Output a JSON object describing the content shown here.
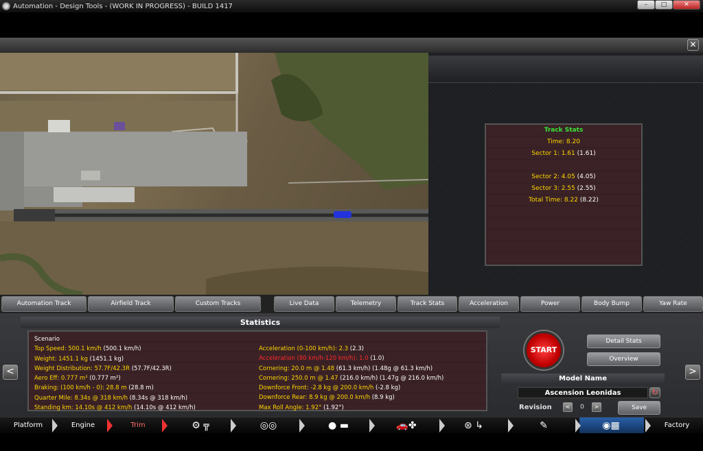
{
  "window": {
    "title": "Automation - Design Tools - (WORK IN PROGRESS) - BUILD 1417",
    "minimize": "–",
    "maximize": "□",
    "close": "✕"
  },
  "panel": {
    "close": "✕"
  },
  "track_stats": {
    "title": "Track Stats",
    "time": "Time: 8.20",
    "lines": [
      {
        "label": "Sector 1: 1.61",
        "paren": "(1.61)"
      },
      {
        "label": "",
        "paren": ""
      },
      {
        "label": "Sector 2: 4.05",
        "paren": "(4.05)"
      },
      {
        "label": "Sector 3: 2.55",
        "paren": "(2.55)"
      },
      {
        "label": "Total Time: 8.22",
        "paren": "(8.22)"
      }
    ]
  },
  "tabs": [
    "Automation Track",
    "Airfield Track",
    "Custom Tracks",
    "Live Data",
    "Telemetry",
    "Track Stats",
    "Acceleration",
    "Power",
    "Body Bump",
    "Yaw Rate"
  ],
  "statistics": {
    "header": "Statistics",
    "scenario": "Scenario",
    "left": [
      {
        "label": "Top Speed: 500.1 km/h",
        "paren": "(500.1 km/h)"
      },
      {
        "label": "Weight: 1451.1 kg",
        "paren": "(1451.1 kg)"
      },
      {
        "label": "Weight Distribution: 57.7F/42.3R",
        "paren": "(57.7F/42.3R)"
      },
      {
        "label": "Aero Eff: 0.777 m²",
        "paren": "(0.777 m²)"
      },
      {
        "label": "Braking: (100 km/h - 0): 28.8 m",
        "paren": "(28.8 m)"
      },
      {
        "label": "Quarter Mile: 8.34s @ 318 km/h",
        "paren": "(8.34s @ 318 km/h)"
      },
      {
        "label": "Standing km: 14.10s @ 412 km/h",
        "paren": "(14.10s @ 412 km/h)"
      }
    ],
    "right": [
      {
        "label": "Acceleration (0-100 km/h): 2.3",
        "paren": "(2.3)"
      },
      {
        "label": "Acceleration (80 km/h-120 km/h): 1.0",
        "paren": "(1.0)"
      },
      {
        "label": "Cornering: 20.0 m @ 1.48",
        "paren": "(61.3 km/h) (1.48g @ 61.3 km/h)"
      },
      {
        "label": "Cornering: 250.0 m @ 1.47",
        "paren": "(216.0 km/h) (1.47g @ 216.0 km/h)"
      },
      {
        "label": "Downforce Front: -2.8 kg @ 200.0 km/h",
        "paren": "(-2.8 kg)"
      },
      {
        "label": "Downforce Rear: 8.9 kg @ 200.0 km/h",
        "paren": "(8.9 kg)"
      },
      {
        "label": "Max Roll Angle: 1.92°",
        "paren": "(1.92°)"
      }
    ]
  },
  "controls": {
    "start": "START",
    "detail_stats": "Detail Stats",
    "overview": "Overview",
    "model_name_header": "Model Name",
    "model_name": "Ascension Leonidas",
    "revision_label": "Revision",
    "revision_value": "0",
    "save": "Save",
    "prev": "<",
    "next": ">",
    "rev_prev": "<",
    "rev_next": ">"
  },
  "nav": {
    "platform": "Platform",
    "engine": "Engine",
    "trim": "Trim",
    "factory": "Factory"
  },
  "colors": {
    "stat_text": "#ffd700",
    "stat_warning": "#ff2a2a",
    "track_title": "#39e639",
    "start_button": "#c00000",
    "active_nav": "#2a5fa8"
  }
}
